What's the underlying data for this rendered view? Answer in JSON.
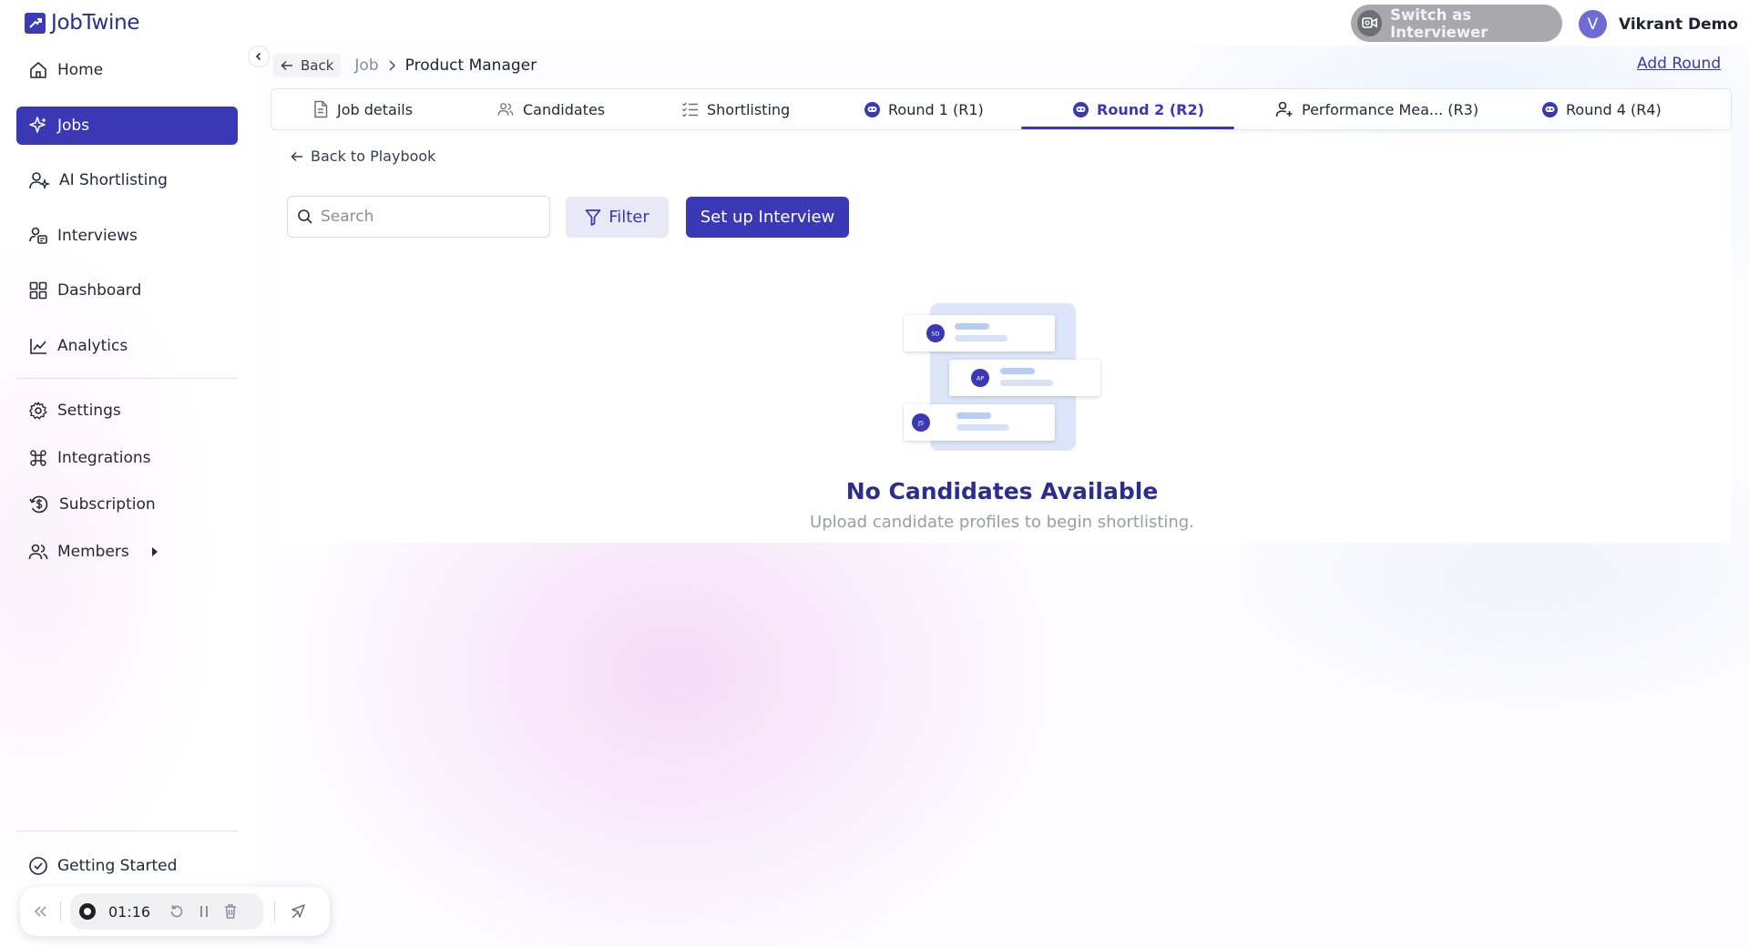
{
  "app": {
    "name": "JobTwine"
  },
  "header": {
    "switch_label": "Switch as Interviewer",
    "user_initial": "V",
    "user_name": "Vikrant Demo"
  },
  "sidebar": {
    "items": [
      {
        "label": "Home",
        "icon": "home-icon"
      },
      {
        "label": "Jobs",
        "icon": "sparkle-icon",
        "active": true
      },
      {
        "label": "AI Shortlisting",
        "icon": "user-ai-icon"
      },
      {
        "label": "Interviews",
        "icon": "interview-icon"
      },
      {
        "label": "Dashboard",
        "icon": "grid-icon"
      },
      {
        "label": "Analytics",
        "icon": "chart-line-icon"
      }
    ],
    "secondary": [
      {
        "label": "Settings",
        "icon": "gear-icon"
      },
      {
        "label": "Integrations",
        "icon": "command-icon"
      },
      {
        "label": "Subscription",
        "icon": "dollar-icon"
      },
      {
        "label": "Members",
        "icon": "users-icon"
      }
    ],
    "getting_started": "Getting Started"
  },
  "recorder": {
    "time": "01:16"
  },
  "breadcrumb": {
    "back": "Back",
    "job": "Job",
    "current": "Product Manager"
  },
  "add_round": "Add Round",
  "tabs": [
    {
      "label": "Job details",
      "icon": "document-icon"
    },
    {
      "label": "Candidates",
      "icon": "users-icon"
    },
    {
      "label": "Shortlisting",
      "icon": "list-check-icon"
    },
    {
      "label": "Round 1 (R1)",
      "icon": "bot-icon"
    },
    {
      "label": "Round 2 (R2)",
      "icon": "bot-icon",
      "active": true
    },
    {
      "label": "Performance Mea... (R3)",
      "icon": "user-plus-icon"
    },
    {
      "label": "Round 4 (R4)",
      "icon": "bot-icon"
    }
  ],
  "content": {
    "back_playbook": "Back to Playbook",
    "search_placeholder": "Search",
    "filter_label": "Filter",
    "setup_label": "Set up Interview",
    "illustration": {
      "initials": [
        "SD",
        "AP",
        "JS"
      ]
    },
    "empty_title": "No Candidates Available",
    "empty_subtitle": "Upload candidate profiles to begin shortlisting."
  },
  "colors": {
    "primary": "#3a38b5",
    "primary_light": "#e8e8f6",
    "muted_text": "#9a9ca6"
  }
}
